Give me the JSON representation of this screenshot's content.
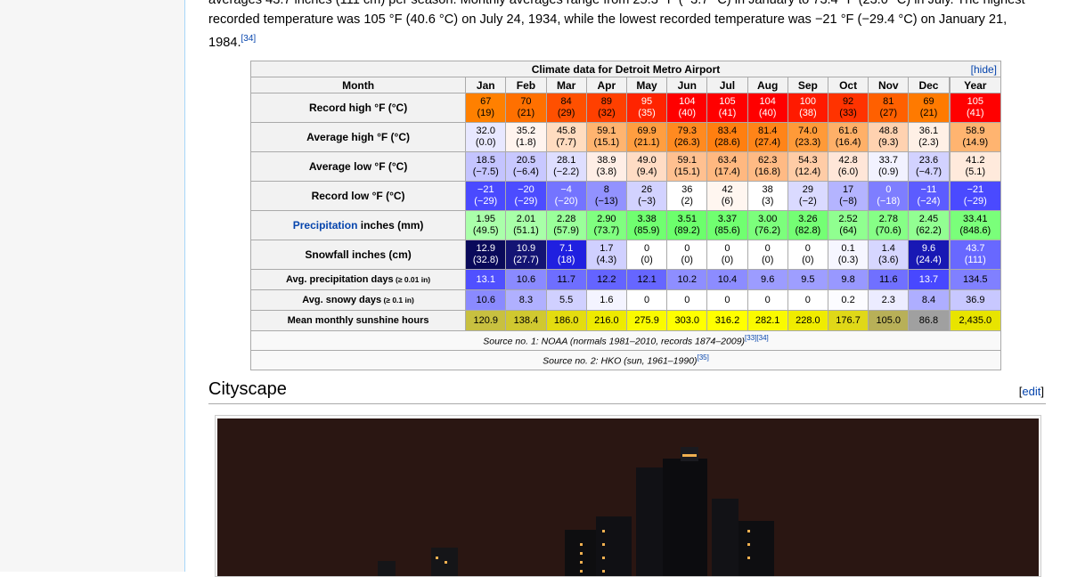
{
  "page": {
    "para_line1": "averages 43.7 inches (111 cm) per season. Monthly averages range from 25.3 °F (−3.7 °C) in January to 73.4 °F (23.0 °C) in July. The highest",
    "para_line2": "recorded temperature was 105 °F (40.6 °C) on July 24, 1934, while the lowest recorded temperature was −21 °F (−29.4 °C) on January 21,",
    "para_line3": "1984.",
    "para_ref": "[34]"
  },
  "climate": {
    "title": "Climate data for Detroit Metro Airport",
    "hide_label": "[hide]",
    "month_header": "Month",
    "months": [
      "Jan",
      "Feb",
      "Mar",
      "Apr",
      "May",
      "Jun",
      "Jul",
      "Aug",
      "Sep",
      "Oct",
      "Nov",
      "Dec",
      "Year"
    ],
    "rows": [
      {
        "label": "Record high °F (°C)",
        "cells": [
          [
            "67",
            "(19)",
            "#ff8000"
          ],
          [
            "70",
            "(21)",
            "#ff7000"
          ],
          [
            "84",
            "(29)",
            "#ff5000"
          ],
          [
            "89",
            "(32)",
            "#ff4000"
          ],
          [
            "95",
            "(35)",
            "#ff2400"
          ],
          [
            "104",
            "(40)",
            "#ff0000"
          ],
          [
            "105",
            "(41)",
            "#ff0000"
          ],
          [
            "104",
            "(40)",
            "#ff0000"
          ],
          [
            "100",
            "(38)",
            "#ff1a00"
          ],
          [
            "92",
            "(33)",
            "#ff3300"
          ],
          [
            "81",
            "(27)",
            "#ff6000"
          ],
          [
            "69",
            "(21)",
            "#ff7a00"
          ],
          [
            "105",
            "(41)",
            "#ff0000"
          ]
        ]
      },
      {
        "label": "Average high °F (°C)",
        "cells": [
          [
            "32.0",
            "(0.0)",
            "#e8e8ff"
          ],
          [
            "35.2",
            "(1.8)",
            "#fff4ee"
          ],
          [
            "45.8",
            "(7.7)",
            "#ffdcc0"
          ],
          [
            "59.1",
            "(15.1)",
            "#ffb470"
          ],
          [
            "69.9",
            "(21.1)",
            "#ff9e40"
          ],
          [
            "79.3",
            "(26.3)",
            "#ff8a20"
          ],
          [
            "83.4",
            "(28.6)",
            "#ff7f10"
          ],
          [
            "81.4",
            "(27.4)",
            "#ff8418"
          ],
          [
            "74.0",
            "(23.3)",
            "#ff9a38"
          ],
          [
            "61.6",
            "(16.4)",
            "#ffb068"
          ],
          [
            "48.8",
            "(9.3)",
            "#ffd2b0"
          ],
          [
            "36.1",
            "(2.3)",
            "#fff0e6"
          ],
          [
            "58.9",
            "(14.9)",
            "#ffb470"
          ]
        ]
      },
      {
        "label": "Average low °F (°C)",
        "cells": [
          [
            "18.5",
            "(−7.5)",
            "#c4c4ff"
          ],
          [
            "20.5",
            "(−6.4)",
            "#c8c8ff"
          ],
          [
            "28.1",
            "(−2.2)",
            "#dedeff"
          ],
          [
            "38.9",
            "(3.8)",
            "#ffeee6"
          ],
          [
            "49.0",
            "(9.4)",
            "#ffdcc4"
          ],
          [
            "59.1",
            "(15.1)",
            "#ffc090"
          ],
          [
            "63.4",
            "(17.4)",
            "#ffb880"
          ],
          [
            "62.3",
            "(16.8)",
            "#ffba84"
          ],
          [
            "54.3",
            "(12.4)",
            "#ffcca6"
          ],
          [
            "42.8",
            "(6.0)",
            "#ffe6d8"
          ],
          [
            "33.7",
            "(0.9)",
            "#f2f2ff"
          ],
          [
            "23.6",
            "(−4.7)",
            "#d2d2ff"
          ],
          [
            "41.2",
            "(5.1)",
            "#ffeadc"
          ]
        ]
      },
      {
        "label": "Record low °F (°C)",
        "cells": [
          [
            "−21",
            "(−29)",
            "#4a4aff"
          ],
          [
            "−20",
            "(−29)",
            "#4c4cff"
          ],
          [
            "−4",
            "(−20)",
            "#7474ff"
          ],
          [
            "8",
            "(−13)",
            "#9292ff"
          ],
          [
            "26",
            "(−3)",
            "#d2d2ff"
          ],
          [
            "36",
            "(2)",
            "#ffffff"
          ],
          [
            "42",
            "(6)",
            "#fff6f0"
          ],
          [
            "38",
            "(3)",
            "#ffffff"
          ],
          [
            "29",
            "(−2)",
            "#dadaff"
          ],
          [
            "17",
            "(−8)",
            "#b4b4ff"
          ],
          [
            "0",
            "(−18)",
            "#7e7eff"
          ],
          [
            "−11",
            "(−24)",
            "#5c5cff"
          ],
          [
            "−21",
            "(−29)",
            "#4a4aff"
          ]
        ]
      },
      {
        "label": "Precipitation",
        "label_suffix": " inches (mm)",
        "cells": [
          [
            "1.95",
            "(49.5)",
            "#aaffaa"
          ],
          [
            "2.01",
            "(51.1)",
            "#a8ffa8"
          ],
          [
            "2.28",
            "(57.9)",
            "#9aff9a"
          ],
          [
            "2.90",
            "(73.7)",
            "#80ff80"
          ],
          [
            "3.38",
            "(85.9)",
            "#70ff70"
          ],
          [
            "3.51",
            "(89.2)",
            "#6cff6c"
          ],
          [
            "3.37",
            "(85.6)",
            "#70ff70"
          ],
          [
            "3.00",
            "(76.2)",
            "#7cff7c"
          ],
          [
            "3.26",
            "(82.8)",
            "#74ff74"
          ],
          [
            "2.52",
            "(64)",
            "#90ff90"
          ],
          [
            "2.78",
            "(70.6)",
            "#86ff86"
          ],
          [
            "2.45",
            "(62.2)",
            "#92ff92"
          ],
          [
            "33.41",
            "(848.6)",
            "#7aff7a"
          ]
        ]
      },
      {
        "label": "Snowfall inches (cm)",
        "cells": [
          [
            "12.9",
            "(32.8)",
            "#0a0a5a"
          ],
          [
            "10.9",
            "(27.7)",
            "#141474"
          ],
          [
            "7.1",
            "(18)",
            "#2020e0"
          ],
          [
            "1.7",
            "(4.3)",
            "#d0d0ff"
          ],
          [
            "0",
            "(0)",
            "#ffffff"
          ],
          [
            "0",
            "(0)",
            "#ffffff"
          ],
          [
            "0",
            "(0)",
            "#ffffff"
          ],
          [
            "0",
            "(0)",
            "#ffffff"
          ],
          [
            "0",
            "(0)",
            "#ffffff"
          ],
          [
            "0.1",
            "(0.3)",
            "#f6f6ff"
          ],
          [
            "1.4",
            "(3.6)",
            "#d6d6ff"
          ],
          [
            "9.6",
            "(24.4)",
            "#1818b4"
          ],
          [
            "43.7",
            "(111)",
            "#6868ff"
          ]
        ]
      },
      {
        "label": "Avg. precipitation days",
        "label_small": " (≥ 0.01 in)",
        "cells": [
          [
            "13.1",
            "",
            "#5050ff"
          ],
          [
            "10.6",
            "",
            "#8a8aff"
          ],
          [
            "11.7",
            "",
            "#6e6eff"
          ],
          [
            "12.2",
            "",
            "#6464ff"
          ],
          [
            "12.1",
            "",
            "#6666ff"
          ],
          [
            "10.2",
            "",
            "#8e8eff"
          ],
          [
            "10.4",
            "",
            "#8c8cff"
          ],
          [
            "9.6",
            "",
            "#9c9cff"
          ],
          [
            "9.5",
            "",
            "#9e9eff"
          ],
          [
            "9.8",
            "",
            "#9898ff"
          ],
          [
            "11.6",
            "",
            "#7070ff"
          ],
          [
            "13.7",
            "",
            "#4848ff"
          ],
          [
            "134.5",
            "",
            "#8080ff"
          ]
        ]
      },
      {
        "label": "Avg. snowy days",
        "label_small": " (≥ 0.1 in)",
        "cells": [
          [
            "10.6",
            "",
            "#8a8aff"
          ],
          [
            "8.3",
            "",
            "#b0b0ff"
          ],
          [
            "5.5",
            "",
            "#d0d0ff"
          ],
          [
            "1.6",
            "",
            "#f4f4ff"
          ],
          [
            "0",
            "",
            "#ffffff"
          ],
          [
            "0",
            "",
            "#ffffff"
          ],
          [
            "0",
            "",
            "#ffffff"
          ],
          [
            "0",
            "",
            "#ffffff"
          ],
          [
            "0",
            "",
            "#ffffff"
          ],
          [
            "0.2",
            "",
            "#fcfcff"
          ],
          [
            "2.3",
            "",
            "#ececff"
          ],
          [
            "8.4",
            "",
            "#aeaeff"
          ],
          [
            "36.9",
            "",
            "#c8c8ff"
          ]
        ]
      },
      {
        "label": "Mean monthly sunshine hours",
        "small_label": true,
        "cells": [
          [
            "120.9",
            "",
            "#c8c040"
          ],
          [
            "138.4",
            "",
            "#d0c830"
          ],
          [
            "186.0",
            "",
            "#e4dc10"
          ],
          [
            "216.0",
            "",
            "#eeea00"
          ],
          [
            "275.9",
            "",
            "#fafa00"
          ],
          [
            "303.0",
            "",
            "#ffff00"
          ],
          [
            "316.2",
            "",
            "#ffff00"
          ],
          [
            "282.1",
            "",
            "#fafa00"
          ],
          [
            "228.0",
            "",
            "#f0ec00"
          ],
          [
            "176.7",
            "",
            "#e0d818"
          ],
          [
            "105.0",
            "",
            "#b8b058"
          ],
          [
            "86.8",
            "",
            "#a0a0a0"
          ],
          [
            "2,435.0",
            "",
            "#e8e400"
          ]
        ]
      }
    ],
    "source1": "Source no. 1: NOAA (normals 1981–2010, records 1874–2009)",
    "source1_refs": "[33][34]",
    "source2": "Source no. 2: HKO (sun, 1961–1990)",
    "source2_refs": "[35]"
  },
  "section": {
    "heading": "Cityscape",
    "edit_open": "[",
    "edit_label": "edit",
    "edit_close": "]"
  }
}
